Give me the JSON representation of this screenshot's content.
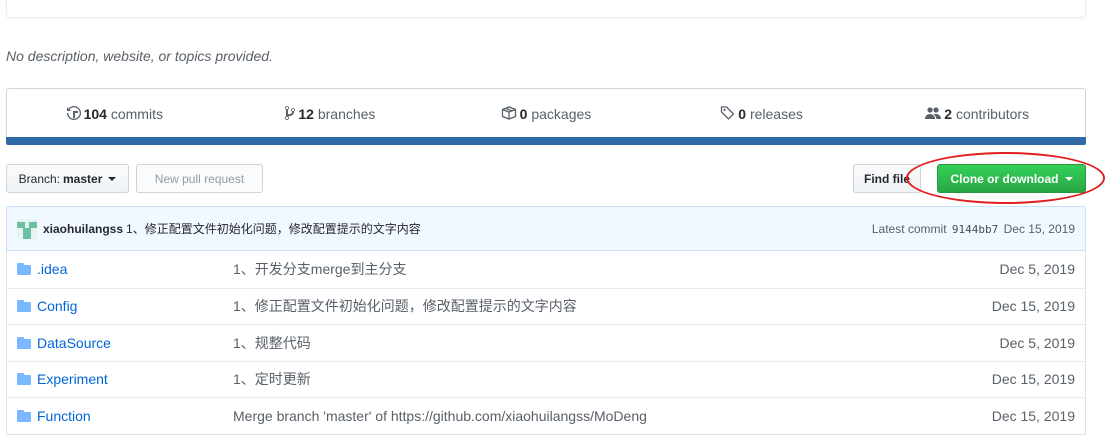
{
  "repo": {
    "description": "No description, website, or topics provided."
  },
  "summary": [
    {
      "icon": "history-icon",
      "count": "104",
      "label": "commits"
    },
    {
      "icon": "git-branch-icon",
      "count": "12",
      "label": "branches"
    },
    {
      "icon": "package-icon",
      "count": "0",
      "label": "packages"
    },
    {
      "icon": "tag-icon",
      "count": "0",
      "label": "releases"
    },
    {
      "icon": "people-icon",
      "count": "2",
      "label": "contributors"
    }
  ],
  "language_bar": {
    "color": "#2f6aa8"
  },
  "toolbar": {
    "branch_prefix": "Branch:",
    "branch_name": "master",
    "new_pr_label": "New pull request",
    "find_file_label": "Find file",
    "clone_label": "Clone or download"
  },
  "commit": {
    "author": "xiaohuilangss",
    "message": "1、修正配置文件初始化问题，修改配置提示的文字内容",
    "latest_label": "Latest commit",
    "sha": "9144bb7",
    "date": "Dec 15, 2019"
  },
  "files": [
    {
      "icon": "folder-icon",
      "name": ".idea",
      "message": "1、开发分支merge到主分支",
      "date": "Dec 5, 2019"
    },
    {
      "icon": "folder-icon",
      "name": "Config",
      "message": "1、修正配置文件初始化问题，修改配置提示的文字内容",
      "date": "Dec 15, 2019"
    },
    {
      "icon": "folder-icon",
      "name": "DataSource",
      "message": "1、规整代码",
      "date": "Dec 5, 2019"
    },
    {
      "icon": "folder-icon",
      "name": "Experiment",
      "message": "1、定时更新",
      "date": "Dec 15, 2019"
    },
    {
      "icon": "folder-icon",
      "name": "Function",
      "message": "Merge branch 'master' of https://github.com/xiaohuilangss/MoDeng",
      "date": "Dec 15, 2019"
    }
  ],
  "colors": {
    "link": "#0366d6",
    "clone_button": "#28a745",
    "annotation_circle": "#e0201f",
    "folder": "#79b8ff"
  }
}
